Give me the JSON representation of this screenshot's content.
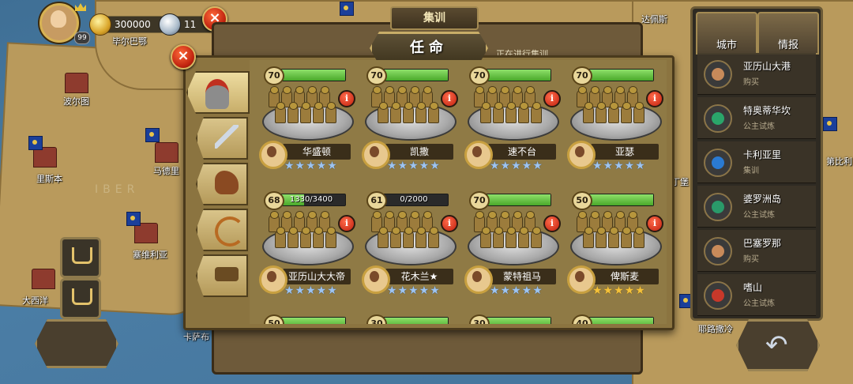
{
  "hud": {
    "player_level": "99",
    "gold": "300000",
    "medals": "11"
  },
  "map_labels": [
    "毕尔巴鄂",
    "波尔图",
    "里斯本",
    "马德里",
    "塞维利亚",
    "大西洋",
    "卡萨布",
    "达佩斯",
    "第比利",
    "耶路撒冷",
    "丁堡"
  ],
  "map_watermark": "IBER",
  "back_panel": {
    "title": "集训",
    "subtitle": "正在进行集训"
  },
  "dialog": {
    "title": "任命",
    "categories": [
      {
        "icon": "helmet-icon",
        "active": true
      },
      {
        "icon": "sword-icon",
        "active": false
      },
      {
        "icon": "horse-icon",
        "active": false
      },
      {
        "icon": "bow-icon",
        "active": false
      },
      {
        "icon": "cannon-icon",
        "active": false
      }
    ],
    "units": [
      {
        "level": "70",
        "bar_text": "",
        "fill": 1.0,
        "hero": "华盛顿",
        "stars": "★★★★★",
        "star_color": "blue"
      },
      {
        "level": "70",
        "bar_text": "",
        "fill": 1.0,
        "hero": "凯撒",
        "stars": "★★★★★",
        "star_color": "blue"
      },
      {
        "level": "70",
        "bar_text": "",
        "fill": 1.0,
        "hero": "速不台",
        "stars": "★★★★★",
        "star_color": "blue"
      },
      {
        "level": "70",
        "bar_text": "",
        "fill": 1.0,
        "hero": "亚瑟",
        "stars": "★★★★★",
        "star_color": "blue"
      },
      {
        "level": "68",
        "bar_text": "1330/3400",
        "fill": 0.39,
        "hero": "亚历山大大帝",
        "stars": "★★★★★",
        "star_color": "blue"
      },
      {
        "level": "61",
        "bar_text": "0/2000",
        "fill": 0.0,
        "hero": "花木兰★",
        "stars": "★★★★★",
        "star_color": "blue"
      },
      {
        "level": "70",
        "bar_text": "",
        "fill": 1.0,
        "hero": "蒙特祖马",
        "stars": "★★★★★",
        "star_color": "blue"
      },
      {
        "level": "50",
        "bar_text": "",
        "fill": 1.0,
        "hero": "俾斯麦",
        "stars": "★★★★★",
        "star_color": "gold"
      }
    ],
    "peek_levels": [
      "50",
      "30",
      "30",
      "40"
    ]
  },
  "side_panel": {
    "tabs": [
      "城市",
      "情报"
    ],
    "cities": [
      {
        "name": "亚历山大港",
        "status": "购买",
        "icon": "scale"
      },
      {
        "name": "特奥蒂华坎",
        "status": "公主试炼",
        "icon": "shield"
      },
      {
        "name": "卡利亚里",
        "status": "集训",
        "icon": "sun"
      },
      {
        "name": "婆罗洲岛",
        "status": "公主试炼",
        "icon": "gem"
      },
      {
        "name": "巴塞罗那",
        "status": "购买",
        "icon": "scale"
      },
      {
        "name": "嗜山",
        "status": "公主试炼",
        "icon": "red"
      }
    ]
  }
}
